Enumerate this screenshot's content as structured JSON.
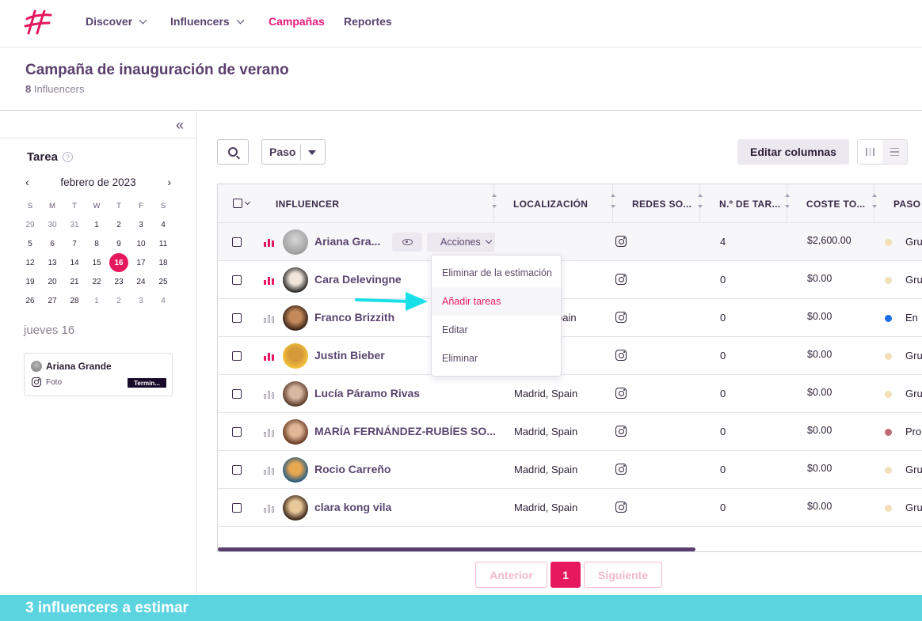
{
  "nav": {
    "items": [
      {
        "label": "Discover"
      },
      {
        "label": "Influencers"
      },
      {
        "label": "Campañas"
      },
      {
        "label": "Reportes"
      }
    ]
  },
  "campaign": {
    "title": "Campaña de inauguración de verano",
    "count": "8",
    "count_label": "Influencers"
  },
  "sidebar": {
    "tarea_title": "Tarea",
    "help_icon": "?",
    "calendar": {
      "month": "febrero de 2023",
      "weekdays": [
        "S",
        "M",
        "T",
        "W",
        "T",
        "F",
        "S"
      ],
      "weeks": [
        [
          "29",
          "30",
          "31",
          "1",
          "2",
          "3",
          "4"
        ],
        [
          "5",
          "6",
          "7",
          "8",
          "9",
          "10",
          "11"
        ],
        [
          "12",
          "13",
          "14",
          "15",
          "16",
          "17",
          "18"
        ],
        [
          "19",
          "20",
          "21",
          "22",
          "23",
          "24",
          "25"
        ],
        [
          "26",
          "27",
          "28",
          "1",
          "2",
          "3",
          "4"
        ]
      ],
      "selected_day": "16"
    },
    "day_label": "jueves 16",
    "task": {
      "name": "Ariana Grande",
      "type": "Foto",
      "status": "Termin..."
    }
  },
  "toolbar": {
    "paso_label": "Paso",
    "edit_columns": "Editar columnas"
  },
  "table": {
    "columns": [
      "INFLUENCER",
      "LOCALIZACIÓN",
      "REDES SO...",
      "N.º DE TAR...",
      "COSTE TO...",
      "PASO"
    ],
    "rows": [
      {
        "name": "Ariana Gra...",
        "location": "",
        "tasks": "4",
        "cost": "$2,600.00",
        "step": "Gru",
        "step_color": "#f3dfb8",
        "highlight": true
      },
      {
        "name": "Cara Delevingne",
        "location": "",
        "tasks": "0",
        "cost": "$0.00",
        "step": "Gru",
        "step_color": "#f3dfb8",
        "highlight": true
      },
      {
        "name": "Franco Brizzith",
        "location": "pain",
        "tasks": "0",
        "cost": "$0.00",
        "step": "En",
        "step_color": "#1a6fe6",
        "highlight": false
      },
      {
        "name": "Justin Bieber",
        "location": "",
        "tasks": "0",
        "cost": "$0.00",
        "step": "Gru",
        "step_color": "#f3dfb8",
        "highlight": true
      },
      {
        "name": "Lucía Páramo Rivas",
        "location": "Madrid, Spain",
        "tasks": "0",
        "cost": "$0.00",
        "step": "Gru",
        "step_color": "#f3dfb8",
        "highlight": false
      },
      {
        "name": "MARÍA FERNÁNDEZ-RUBÍES SO...",
        "location": "Madrid, Spain",
        "tasks": "0",
        "cost": "$0.00",
        "step": "Pro",
        "step_color": "#c06a78",
        "highlight": false
      },
      {
        "name": "Rocio Carreño",
        "location": "Madrid, Spain",
        "tasks": "0",
        "cost": "$0.00",
        "step": "Gru",
        "step_color": "#f3dfb8",
        "highlight": false
      },
      {
        "name": "clara kong vila",
        "location": "Madrid, Spain",
        "tasks": "0",
        "cost": "$0.00",
        "step": "Gru",
        "step_color": "#f3dfb8",
        "highlight": false
      }
    ],
    "actions_label": "Acciones",
    "dropdown": [
      "Eliminar de la estimación",
      "Añadir tareas",
      "Editar",
      "Eliminar"
    ]
  },
  "pagination": {
    "prev": "Anterior",
    "current": "1",
    "next": "Siguiente"
  },
  "banner": "3 influencers a estimar",
  "colors": {
    "accent": "#e6195f",
    "nav_text": "#5a4570",
    "banner": "#5bd4e0",
    "annotation_arrow": "#19e0e8"
  }
}
